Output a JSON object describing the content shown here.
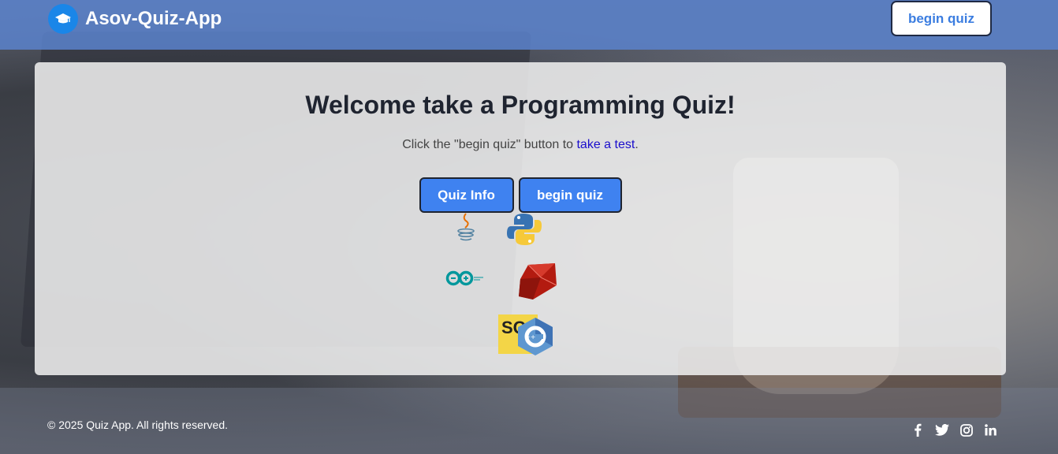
{
  "navbar": {
    "title": "Asov-Quiz-App",
    "logo_icon": "graduation-cap-icon",
    "begin_button": "begin quiz"
  },
  "main": {
    "heading": "Welcome take a Programming Quiz!",
    "subtitle_prefix": "Click the \"begin quiz\" button to ",
    "subtitle_link": "take a test",
    "subtitle_suffix": ".",
    "quiz_info_button": "Quiz Info",
    "begin_quiz_button": "begin quiz",
    "language_logos": [
      "java-icon",
      "python-icon",
      "arduino-icon",
      "ruby-icon",
      "sql-icon",
      "cpp-icon"
    ],
    "sql_logo_text": "SQ"
  },
  "footer": {
    "copyright": "© 2025 Quiz App. All rights reserved.",
    "social_icons": [
      "facebook-icon",
      "twitter-icon",
      "instagram-icon",
      "linkedin-icon"
    ]
  }
}
